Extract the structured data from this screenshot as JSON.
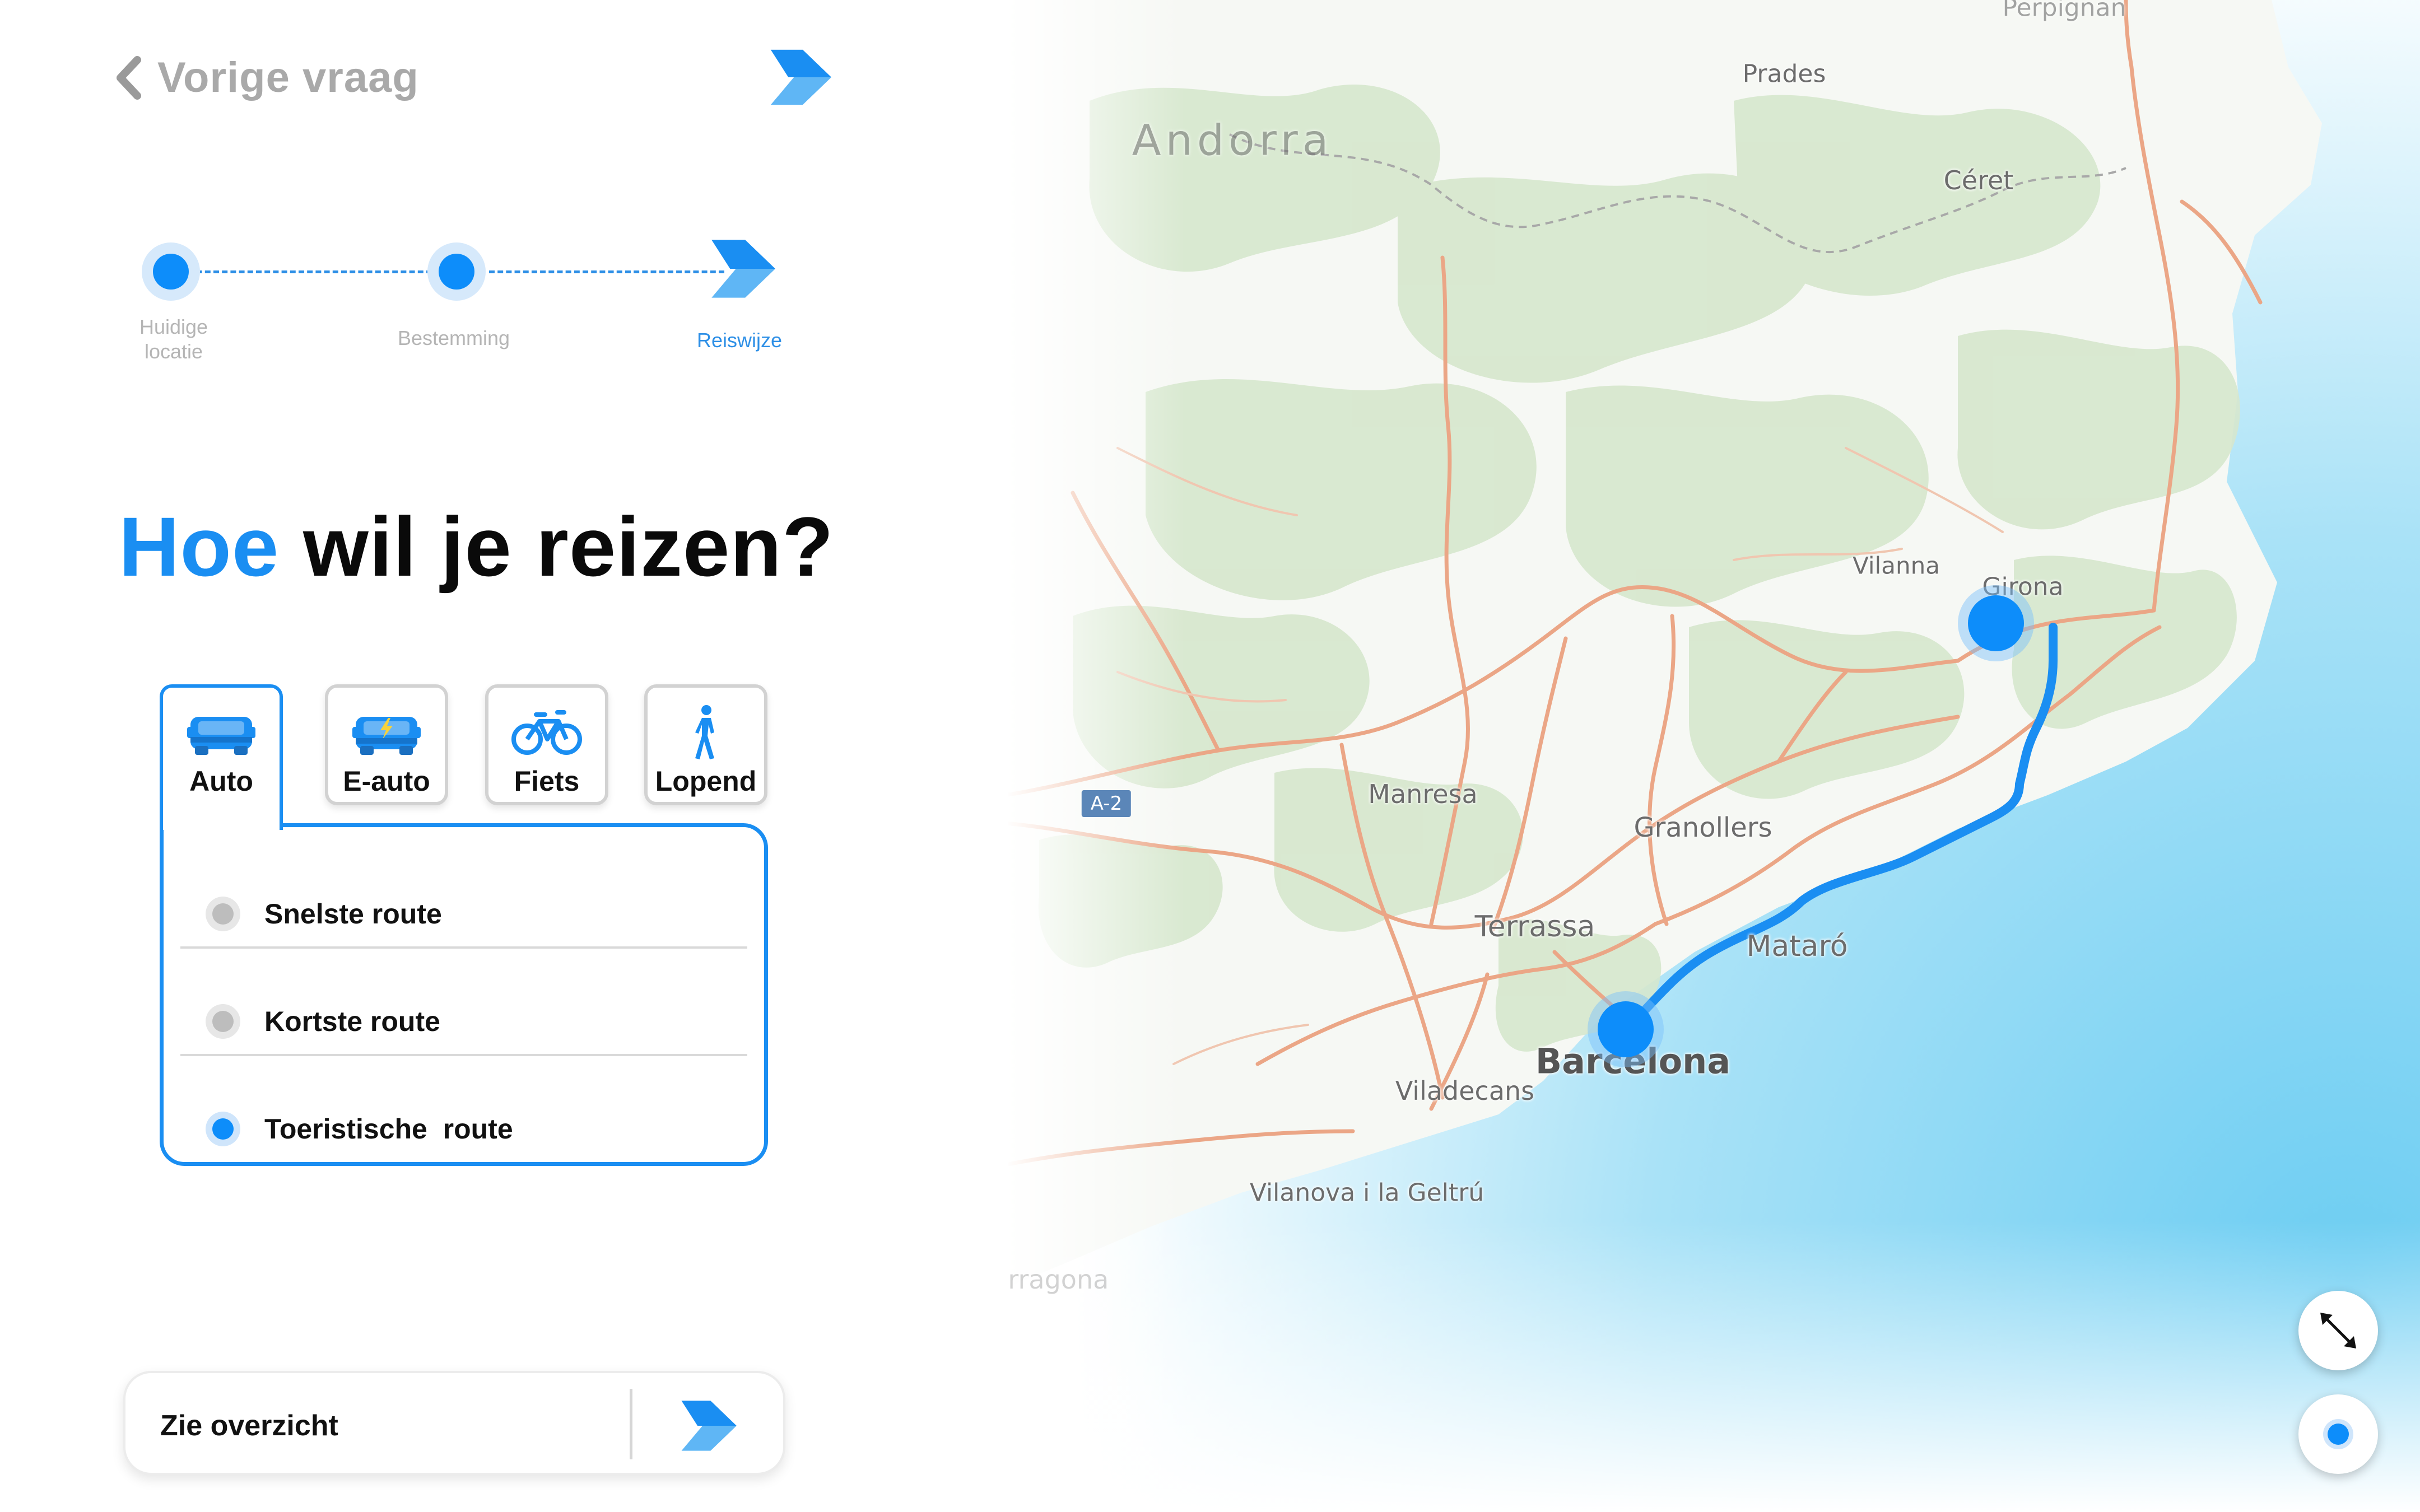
{
  "nav": {
    "back_label": "Vorige vraag"
  },
  "stepper": {
    "steps": [
      {
        "label": "Huidige locatie",
        "state": "done"
      },
      {
        "label": "Bestemming",
        "state": "done"
      },
      {
        "label": "Reiswijze",
        "state": "active"
      }
    ]
  },
  "heading": {
    "accent": "Hoe",
    "rest": "wil je reizen?"
  },
  "transport": {
    "modes": [
      {
        "label": "Auto",
        "icon": "car-icon",
        "active": true
      },
      {
        "label": "E-auto",
        "icon": "electric-car-icon",
        "active": false
      },
      {
        "label": "Fiets",
        "icon": "bicycle-icon",
        "active": false
      },
      {
        "label": "Lopend",
        "icon": "walking-icon",
        "active": false
      }
    ]
  },
  "route_options": [
    {
      "label": "Snelste route",
      "selected": false
    },
    {
      "label": "Kortste route",
      "selected": false
    },
    {
      "label": "Toeristische  route",
      "selected": true
    }
  ],
  "overview": {
    "label": "Zie overzicht"
  },
  "map": {
    "labels": {
      "perpignan": "Perpignan",
      "prades": "Prades",
      "andorra": "Andorra",
      "ceret": "Céret",
      "vilanna": "Vilanna",
      "girona": "Girona",
      "manresa": "Manresa",
      "granollers": "Granollers",
      "terrassa": "Terrassa",
      "mataro": "Mataró",
      "barcelona": "Barcelona",
      "viladecans": "Viladecans",
      "vilanova": "Vilanova i la Geltrú",
      "tarragona": "Tarragona"
    },
    "road_badge": "A-2"
  },
  "colors": {
    "accent": "#1a8ef2",
    "route": "#1a8ef2",
    "sea": "#8fd6f2",
    "land_green": "#d7e8cf",
    "road": "#e9a585"
  }
}
